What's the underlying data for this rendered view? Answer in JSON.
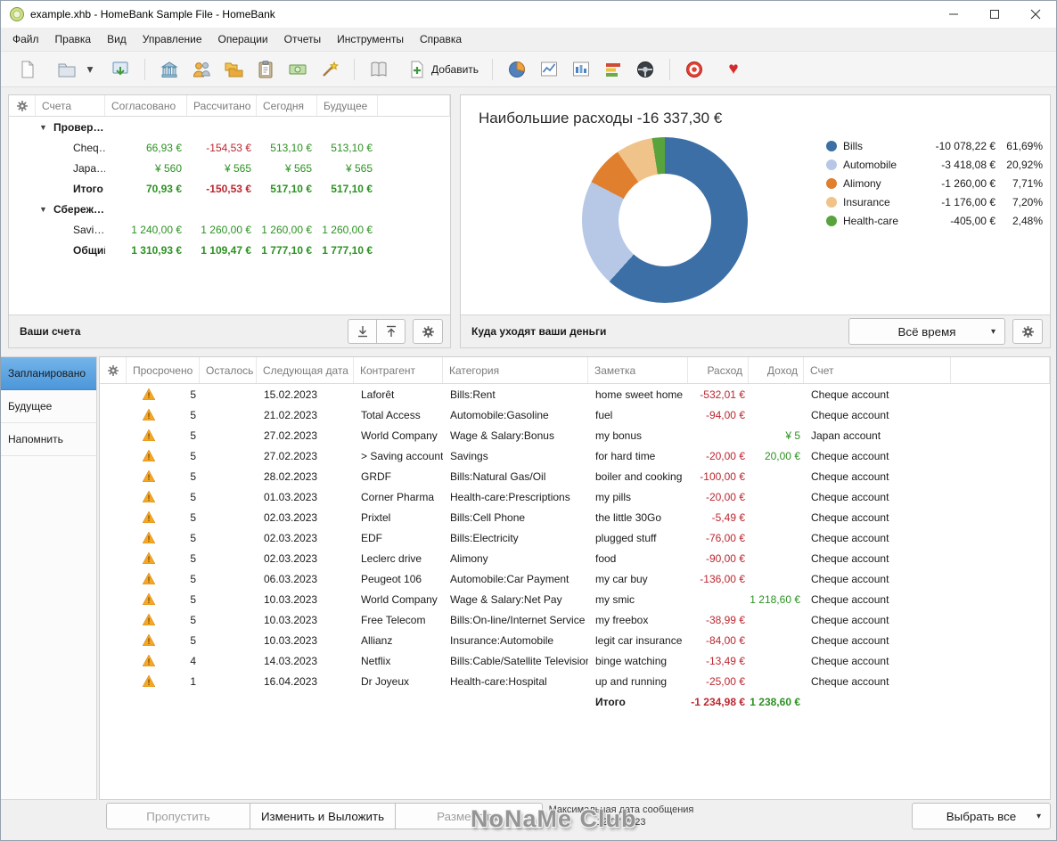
{
  "window": {
    "title": "example.xhb - HomeBank Sample File - HomeBank"
  },
  "menu": {
    "items": [
      "Файл",
      "Правка",
      "Вид",
      "Управление",
      "Операции",
      "Отчеты",
      "Инструменты",
      "Справка"
    ]
  },
  "toolbar": {
    "add_label": "Добавить"
  },
  "icons": {
    "gear": "gear",
    "dropdown": "▾",
    "expander": "▼",
    "heart": "♥",
    "warning": "triangle-exclamation",
    "minimize": "line",
    "maximize": "square",
    "close": "x"
  },
  "accounts": {
    "columns": [
      "Счета",
      "Согласовано",
      "Рассчитано",
      "Сегодня",
      "Будущее"
    ],
    "rows": [
      {
        "type": "group",
        "name": "Провер…"
      },
      {
        "type": "account",
        "name": "Cheq…",
        "reconciled": "66,93 €",
        "cleared": "-154,53 €",
        "today": "513,10 €",
        "future": "513,10 €"
      },
      {
        "type": "account",
        "name": "Japa…",
        "reconciled": "¥ 560",
        "cleared": "¥ 565",
        "today": "¥ 565",
        "future": "¥ 565"
      },
      {
        "type": "total",
        "name": "Итого",
        "reconciled": "70,93 €",
        "cleared": "-150,53 €",
        "today": "517,10 €",
        "future": "517,10 €"
      },
      {
        "type": "group",
        "name": "Сбереж…"
      },
      {
        "type": "account",
        "name": "Savi…",
        "reconciled": "1 240,00 €",
        "cleared": "1 260,00 €",
        "today": "1 260,00 €",
        "future": "1 260,00 €"
      },
      {
        "type": "total",
        "name": "Общий…",
        "reconciled": "1 310,93 €",
        "cleared": "1 109,47 €",
        "today": "1 777,10 €",
        "future": "1 777,10 €"
      }
    ],
    "footer_label": "Ваши счета"
  },
  "chart_data": {
    "type": "pie",
    "title": "Наибольшие расходы -16 337,30 €",
    "legend_position": "right",
    "series": [
      {
        "name": "Bills",
        "amount": "-10 078,22 €",
        "percent": "61,69%",
        "value": 61.69,
        "color": "#3c6fa5"
      },
      {
        "name": "Automobile",
        "amount": "-3 418,08 €",
        "percent": "20,92%",
        "value": 20.92,
        "color": "#b7c8e6"
      },
      {
        "name": "Alimony",
        "amount": "-1 260,00 €",
        "percent": "7,71%",
        "value": 7.71,
        "color": "#e07f2e"
      },
      {
        "name": "Insurance",
        "amount": "-1 176,00 €",
        "percent": "7,20%",
        "value": 7.2,
        "color": "#efc389"
      },
      {
        "name": "Health-care",
        "amount": "-405,00 €",
        "percent": "2,48%",
        "value": 2.48,
        "color": "#59a33c"
      }
    ],
    "footer_label": "Куда уходят ваши деньги",
    "period": "Всё время"
  },
  "scheduled": {
    "tabs": [
      {
        "label": "Запланировано",
        "state": "active"
      },
      {
        "label": "Будущее",
        "state": ""
      },
      {
        "label": "Напомнить",
        "state": ""
      }
    ],
    "columns": [
      "Просрочено",
      "Осталось",
      "Следующая дата",
      "Контрагент",
      "Категория",
      "Заметка",
      "Расход",
      "Доход",
      "Счет"
    ],
    "rows": [
      {
        "late": "5",
        "date": "15.02.2023",
        "payee": "Laforêt",
        "category": "Bills:Rent",
        "memo": "home sweet home",
        "expense": "-532,01 €",
        "income": "",
        "account": "Cheque account"
      },
      {
        "late": "5",
        "date": "21.02.2023",
        "payee": "Total Access",
        "category": "Automobile:Gasoline",
        "memo": "fuel",
        "expense": "-94,00 €",
        "income": "",
        "account": "Cheque account"
      },
      {
        "late": "5",
        "date": "27.02.2023",
        "payee": "World Company",
        "category": "Wage & Salary:Bonus",
        "memo": "my bonus",
        "expense": "",
        "income": "¥ 5",
        "account": "Japan account"
      },
      {
        "late": "5",
        "date": "27.02.2023",
        "payee": "> Saving account",
        "category": "Savings",
        "memo": "for hard time",
        "expense": "-20,00 €",
        "income": "20,00 €",
        "account": "Cheque account"
      },
      {
        "late": "5",
        "date": "28.02.2023",
        "payee": "GRDF",
        "category": "Bills:Natural Gas/Oil",
        "memo": "boiler and cooking",
        "expense": "-100,00 €",
        "income": "",
        "account": "Cheque account"
      },
      {
        "late": "5",
        "date": "01.03.2023",
        "payee": "Corner Pharma",
        "category": "Health-care:Prescriptions",
        "memo": "my pills",
        "expense": "-20,00 €",
        "income": "",
        "account": "Cheque account"
      },
      {
        "late": "5",
        "date": "02.03.2023",
        "payee": "Prixtel",
        "category": "Bills:Cell Phone",
        "memo": "the little 30Go",
        "expense": "-5,49 €",
        "income": "",
        "account": "Cheque account"
      },
      {
        "late": "5",
        "date": "02.03.2023",
        "payee": "EDF",
        "category": "Bills:Electricity",
        "memo": "plugged stuff",
        "expense": "-76,00 €",
        "income": "",
        "account": "Cheque account"
      },
      {
        "late": "5",
        "date": "02.03.2023",
        "payee": "Leclerc drive",
        "category": "Alimony",
        "memo": "food",
        "expense": "-90,00 €",
        "income": "",
        "account": "Cheque account"
      },
      {
        "late": "5",
        "date": "06.03.2023",
        "payee": "Peugeot 106",
        "category": "Automobile:Car Payment",
        "memo": "my car buy",
        "expense": "-136,00 €",
        "income": "",
        "account": "Cheque account"
      },
      {
        "late": "5",
        "date": "10.03.2023",
        "payee": "World Company",
        "category": "Wage & Salary:Net Pay",
        "memo": "my smic",
        "expense": "",
        "income": "1 218,60 €",
        "account": "Cheque account"
      },
      {
        "late": "5",
        "date": "10.03.2023",
        "payee": "Free Telecom",
        "category": "Bills:On-line/Internet Service",
        "memo": "my freebox",
        "expense": "-38,99 €",
        "income": "",
        "account": "Cheque account"
      },
      {
        "late": "5",
        "date": "10.03.2023",
        "payee": "Allianz",
        "category": "Insurance:Automobile",
        "memo": "legit car insurance",
        "expense": "-84,00 €",
        "income": "",
        "account": "Cheque account"
      },
      {
        "late": "4",
        "date": "14.03.2023",
        "payee": "Netflix",
        "category": "Bills:Cable/Satellite Television",
        "memo": "binge watching",
        "expense": "-13,49 €",
        "income": "",
        "account": "Cheque account"
      },
      {
        "late": "1",
        "date": "16.04.2023",
        "payee": "Dr Joyeux",
        "category": "Health-care:Hospital",
        "memo": "up and running",
        "expense": "-25,00 €",
        "income": "",
        "account": "Cheque account"
      }
    ],
    "total": {
      "label": "Итого",
      "expense": "-1 234,98 €",
      "income": "1 238,60 €"
    },
    "footer": {
      "skip_label": "Пропустить",
      "edit_post_label": "Изменить и Выложить",
      "post_label": "Разместить",
      "max_date_label": "Максимальная дата сообщения",
      "max_date_value": "12.07.2023",
      "select_all_label": "Выбрать все"
    }
  },
  "watermark": "NoNaMe Club"
}
